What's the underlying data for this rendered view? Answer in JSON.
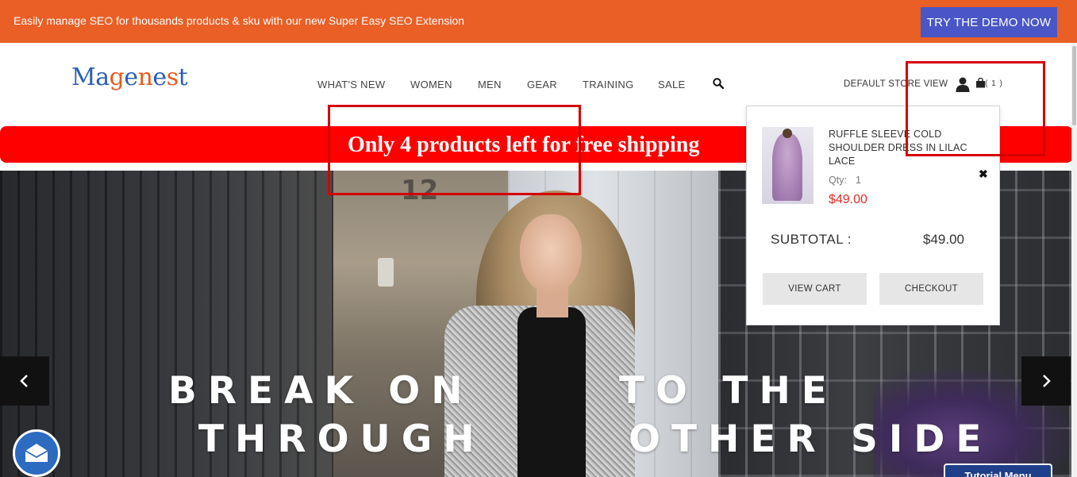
{
  "promo": {
    "text": "Easily manage SEO for thousands products & sku with our new Super Easy SEO Extension",
    "button_label": "TRY THE DEMO NOW",
    "color": "#e95f25",
    "button_color": "#4a56c6"
  },
  "header": {
    "logo": {
      "letters": [
        "M",
        "a",
        "g",
        "e",
        "n",
        "e",
        "s",
        "t"
      ],
      "colors": [
        "#2a5fb4",
        "#2a5fb4",
        "#e85a1e",
        "#2a5fb4",
        "#e85a1e",
        "#2a5fb4",
        "#e85a1e",
        "#2a5fb4"
      ]
    },
    "nav": [
      "WHAT'S NEW",
      "WOMEN",
      "MEN",
      "GEAR",
      "TRAINING",
      "SALE"
    ],
    "store_view": "DEFAULT STORE VIEW",
    "cart_count": "( 1 )"
  },
  "shipping_notice": {
    "text": "Only 4 products left for free shipping",
    "color": "#fe0000"
  },
  "hero": {
    "line1": [
      "BREAK ON",
      "TO THE"
    ],
    "line2": [
      "THROUGH",
      "OTHER SIDE"
    ],
    "house_number": "12"
  },
  "minicart": {
    "item_name": "RUFFLE SLEEVE COLD SHOULDER DRESS IN LILAC LACE",
    "qty_label": "Qty:",
    "qty_value": "1",
    "price": "$49.00",
    "remove": "✖",
    "subtotal_label": "SUBTOTAL :",
    "subtotal_value": "$49.00",
    "view_cart_label": "VIEW CART",
    "checkout_label": "CHECKOUT",
    "price_color": "#e02b27"
  },
  "widgets": {
    "tutorial_label": "Tutorial Menu",
    "chat_icon": "envelope-icon"
  },
  "annotation_color": "#d40000"
}
